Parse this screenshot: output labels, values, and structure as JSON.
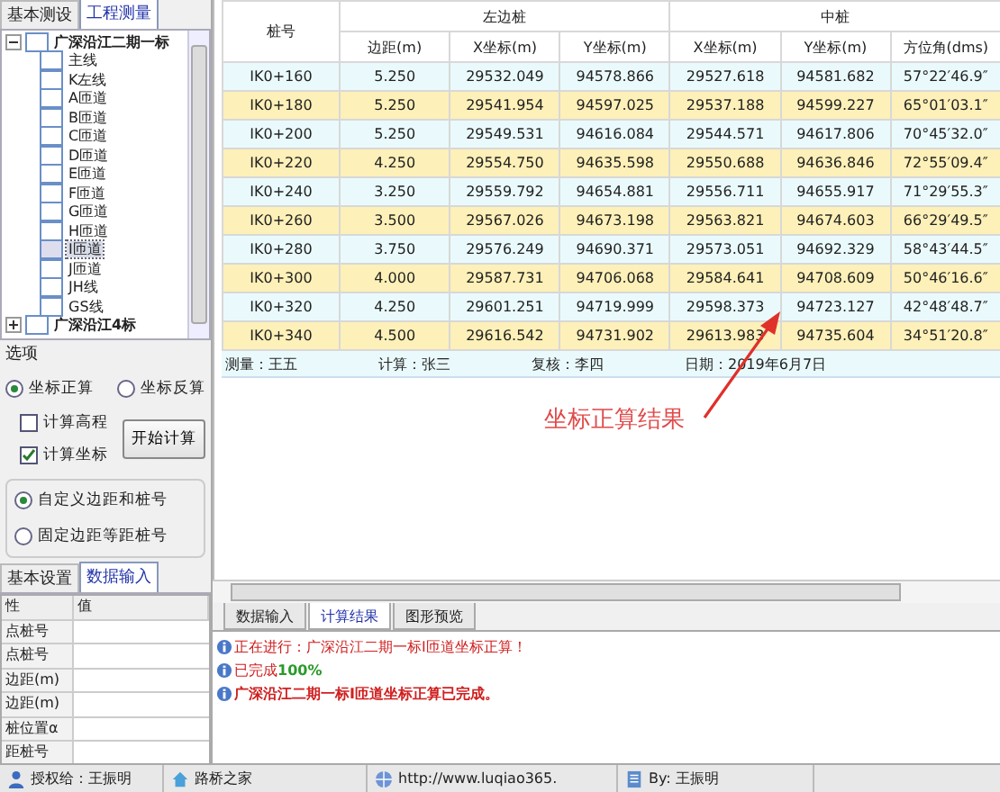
{
  "left_tabs": [
    {
      "label": "基本测设",
      "selected": false
    },
    {
      "label": "工程测量",
      "selected": true
    }
  ],
  "tree": [
    {
      "label": "广深沿江二期一标",
      "expanded": true,
      "children": [
        {
          "label": "主线",
          "selected": false
        },
        {
          "label": "K左线",
          "selected": false
        },
        {
          "label": "A匝道",
          "selected": false
        },
        {
          "label": "B匝道",
          "selected": false
        },
        {
          "label": "C匝道",
          "selected": false
        },
        {
          "label": "D匝道",
          "selected": false
        },
        {
          "label": "E匝道",
          "selected": false
        },
        {
          "label": "F匝道",
          "selected": false
        },
        {
          "label": "G匝道",
          "selected": false
        },
        {
          "label": "H匝道",
          "selected": false
        },
        {
          "label": "I匝道",
          "selected": true
        },
        {
          "label": "J匝道",
          "selected": false
        },
        {
          "label": "JH线",
          "selected": false
        },
        {
          "label": "GS线",
          "selected": false
        }
      ]
    },
    {
      "label": "广深沿江4标",
      "expanded": false
    }
  ],
  "options": {
    "title": "选项",
    "mode_radios": [
      {
        "label": "坐标正算",
        "selected": true
      },
      {
        "label": "坐标反算",
        "selected": false
      }
    ],
    "checkboxes": [
      {
        "label": "计算高程",
        "checked": false
      },
      {
        "label": "计算坐标",
        "checked": true
      }
    ],
    "button": "开始计算",
    "stake_radios": [
      {
        "label": "自定义边距和桩号",
        "selected": true
      },
      {
        "label": "固定边距等距桩号",
        "selected": false
      }
    ]
  },
  "bottom_tabs": [
    {
      "label": "基本设置",
      "selected": false
    },
    {
      "label": "数据输入",
      "selected": true
    }
  ],
  "property_grid": {
    "columns": [
      "性",
      "值"
    ],
    "rows": [
      "点桩号",
      "点桩号",
      "边距(m)",
      "边距(m)",
      "桩位置α",
      "距桩号"
    ]
  },
  "table": {
    "group_headers": [
      "左边桩",
      "中桩"
    ],
    "columns": [
      "桩号",
      "边距(m)",
      "X坐标(m)",
      "Y坐标(m)",
      "X坐标(m)",
      "Y坐标(m)",
      "方位角(dms)"
    ],
    "rows": [
      [
        "IK0+160",
        "5.250",
        "29532.049",
        "94578.866",
        "29527.618",
        "94581.682",
        "57°22′46.9″"
      ],
      [
        "IK0+180",
        "5.250",
        "29541.954",
        "94597.025",
        "29537.188",
        "94599.227",
        "65°01′03.1″"
      ],
      [
        "IK0+200",
        "5.250",
        "29549.531",
        "94616.084",
        "29544.571",
        "94617.806",
        "70°45′32.0″"
      ],
      [
        "IK0+220",
        "4.250",
        "29554.750",
        "94635.598",
        "29550.688",
        "94636.846",
        "72°55′09.4″"
      ],
      [
        "IK0+240",
        "3.250",
        "29559.792",
        "94654.881",
        "29556.711",
        "94655.917",
        "71°29′55.3″"
      ],
      [
        "IK0+260",
        "3.500",
        "29567.026",
        "94673.198",
        "29563.821",
        "94674.603",
        "66°29′49.5″"
      ],
      [
        "IK0+280",
        "3.750",
        "29576.249",
        "94690.371",
        "29573.051",
        "94692.329",
        "58°43′44.5″"
      ],
      [
        "IK0+300",
        "4.000",
        "29587.731",
        "94706.068",
        "29584.641",
        "94708.609",
        "50°46′16.6″"
      ],
      [
        "IK0+320",
        "4.250",
        "29601.251",
        "94719.999",
        "29598.373",
        "94723.127",
        "42°48′48.7″"
      ],
      [
        "IK0+340",
        "4.500",
        "29616.542",
        "94731.902",
        "29613.983",
        "94735.604",
        "34°51′20.8″"
      ]
    ],
    "footer": [
      "测量：王五",
      "计算：张三",
      "复核：李四",
      "日期：2019年6月7日"
    ]
  },
  "annotation": "坐标正算结果",
  "log_tabs": [
    {
      "label": "数据输入",
      "selected": false
    },
    {
      "label": "计算结果",
      "selected": true
    },
    {
      "label": "图形预览",
      "selected": false
    }
  ],
  "log": [
    {
      "text": "正在进行：广深沿江二期一标I匝道坐标正算！",
      "bold": false
    },
    {
      "text": "已完成**100%**",
      "bold": false
    },
    {
      "text": "广深沿江二期一标I匝道坐标正算已完成。",
      "bold": true
    }
  ],
  "status_bar": [
    "授权给：王振明",
    "路桥之家",
    "http://www.luqiao365.",
    "By: 王振明"
  ]
}
